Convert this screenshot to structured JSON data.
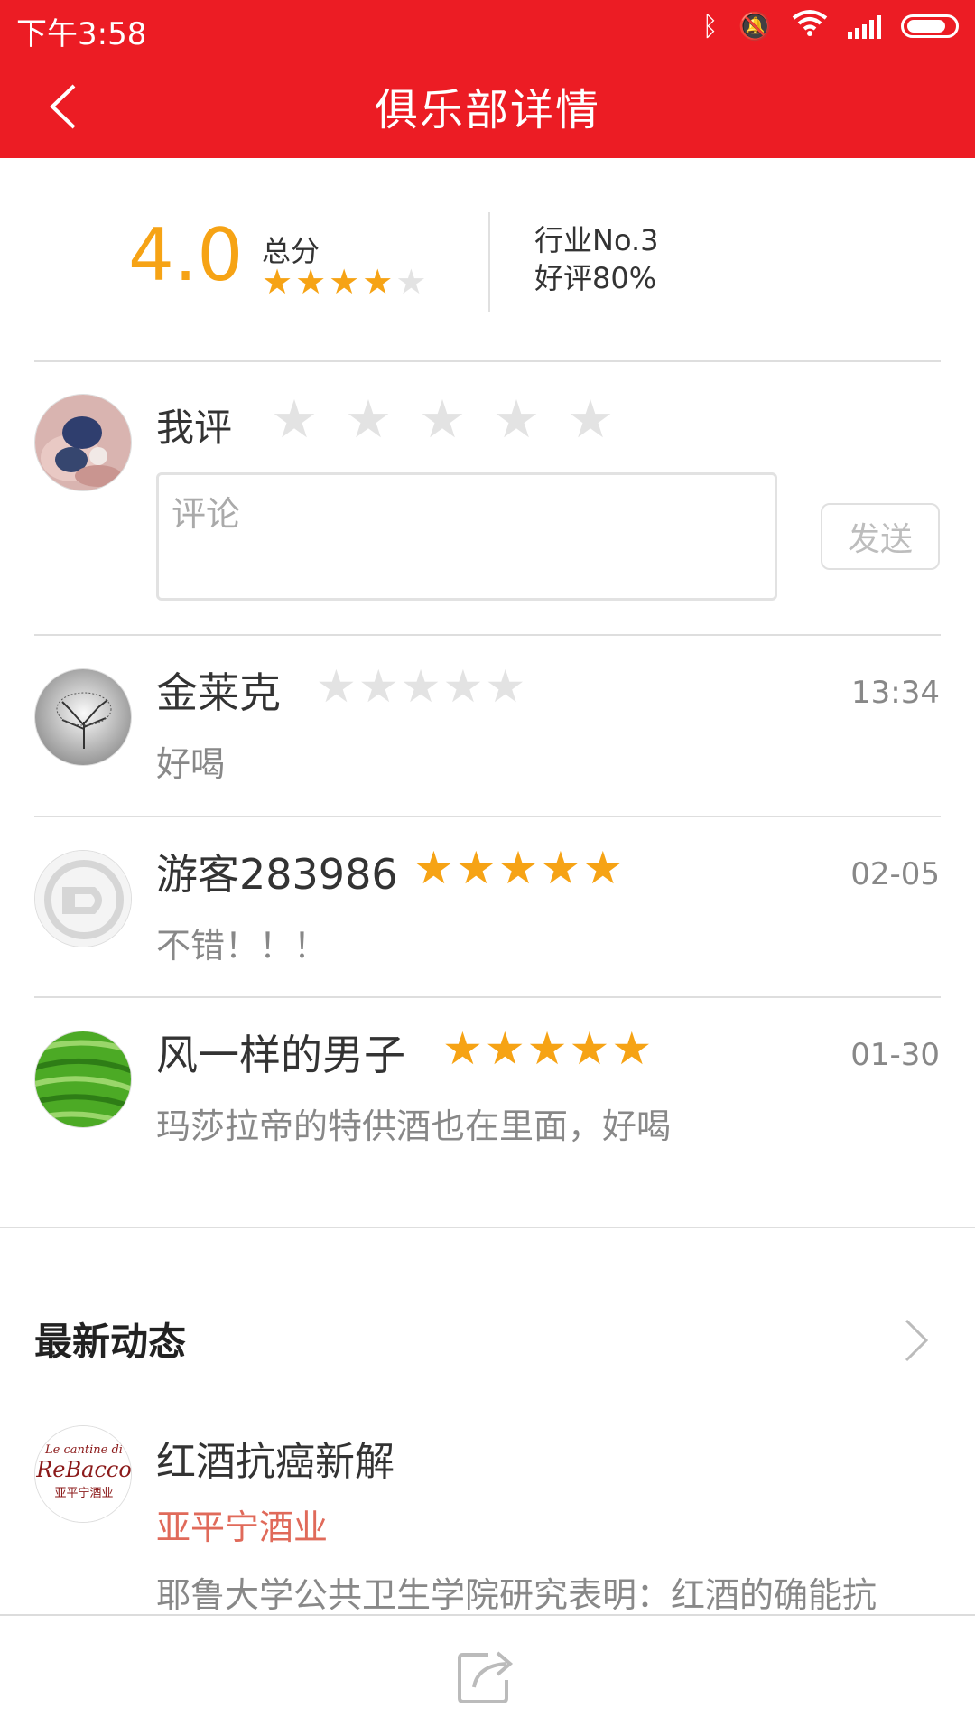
{
  "status_bar": {
    "time": "下午3:58"
  },
  "header": {
    "title": "俱乐部详情"
  },
  "score": {
    "value": "4.0",
    "label": "总分",
    "stars": 4,
    "rank": "行业No.3",
    "good_rate": "好评80%"
  },
  "my_review": {
    "label": "我评",
    "comment_placeholder": "评论",
    "send_label": "发送"
  },
  "reviews": [
    {
      "name": "金莱克",
      "stars": 0,
      "date": "13:34",
      "text": "好喝"
    },
    {
      "name": "游客283986",
      "stars": 5,
      "date": "02-05",
      "text": "不错！！！"
    },
    {
      "name": "风一样的男子",
      "stars": 5,
      "date": "01-30",
      "text": "玛莎拉帝的特供酒也在里面，好喝"
    }
  ],
  "news_section": {
    "title": "最新动态",
    "item": {
      "logo_text": "Le cantine di ReBacco 亚平宁酒业",
      "title": "红酒抗癌新解",
      "source": "亚平宁酒业",
      "desc": "耶鲁大学公共卫生学院研究表明：红酒的确能抗"
    }
  },
  "colors": {
    "brand": "#ec1c24",
    "star_active": "#f6a315",
    "star_inactive": "#e3e3e3",
    "source": "#e06a5a"
  }
}
